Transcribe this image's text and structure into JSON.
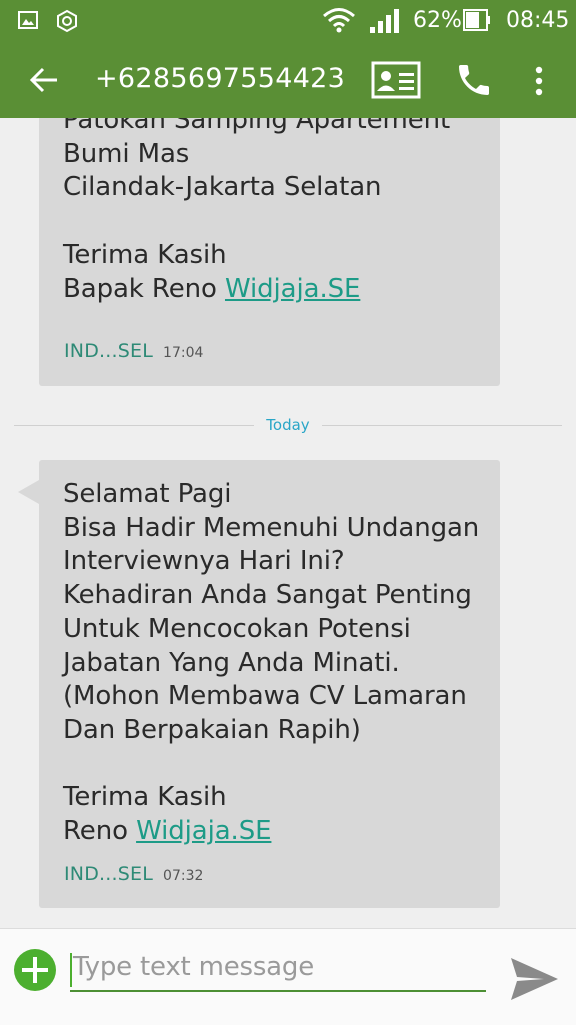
{
  "status_bar": {
    "battery_percent": "62%",
    "time": "08:45",
    "icons": [
      "image-icon",
      "settings-ring-icon",
      "wifi-icon",
      "signal-icon",
      "battery-icon"
    ]
  },
  "app_bar": {
    "title": "+6285697554423",
    "icons": [
      "back-arrow-icon",
      "contact-card-icon",
      "phone-icon",
      "more-vert-icon"
    ]
  },
  "messages": [
    {
      "lines": [
        "Patokan Samping Apartement",
        "Bumi Mas",
        "Cilandak-Jakarta Selatan",
        "",
        "Terima Kasih"
      ],
      "signature_prefix": "Bapak Reno",
      "signature_link": "Widjaja.SE",
      "sender": "IND...SEL",
      "time": "17:04"
    },
    {
      "lines": [
        "Selamat Pagi",
        "Bisa Hadir Memenuhi Undangan",
        "Interviewnya Hari Ini?",
        "Kehadiran Anda Sangat Penting",
        "Untuk Mencocokan Potensi",
        "Jabatan Yang Anda Minati.",
        "(Mohon Membawa CV Lamaran",
        "Dan Berpakaian Rapih)",
        "",
        "Terima Kasih"
      ],
      "signature_prefix": "Reno",
      "signature_link": "Widjaja.SE",
      "sender": "IND...SEL",
      "time": "07:32"
    }
  ],
  "date_divider": "Today",
  "composer": {
    "placeholder": "Type text message",
    "icons": [
      "add-icon",
      "send-icon"
    ]
  },
  "colors": {
    "app_bar": "#5a8f35",
    "bubble": "#d8d8d8",
    "link": "#1d9b87",
    "sender": "#2e8a76",
    "divider_label": "#2aa6c7",
    "add_button": "#4caf2f"
  }
}
